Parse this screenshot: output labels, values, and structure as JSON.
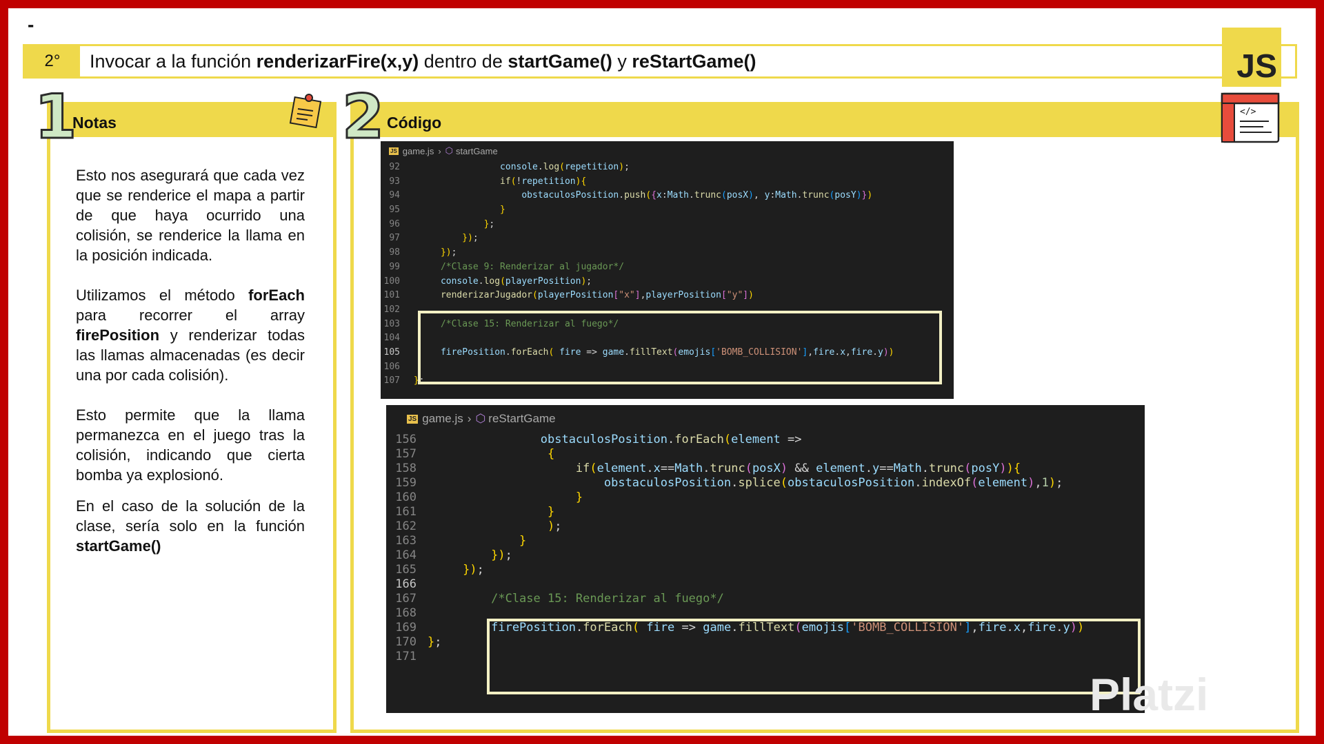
{
  "header": {
    "dash": "-",
    "step": "2°",
    "title_parts": [
      "Invocar a la función ",
      "renderizarFire(x,y)",
      " dentro de ",
      "startGame()",
      " y ",
      "reStartGame()"
    ]
  },
  "badge": "JS",
  "left_panel": {
    "number": "1",
    "label": "Notas",
    "paragraphs": [
      "Esto nos asegurará que cada vez que se renderice el mapa a partir de que haya ocurrido una colisión, se renderice la llama en la posición indicada.",
      [
        "Utilizamos el método ",
        "forEach",
        " para recorrer el array ",
        "firePosition",
        " y renderizar todas las llamas almacenadas (es decir una por cada colisión)."
      ],
      "Esto permite que la llama permanezca en el juego tras la colisión, indicando que cierta bomba ya explosionó.",
      [
        "En el caso de la solución de la clase, sería solo en la función ",
        "startGame()"
      ]
    ]
  },
  "right_panel": {
    "number": "2",
    "label": "Código"
  },
  "code1": {
    "file": "game.js",
    "symbol": "startGame",
    "current_line": "105",
    "lines": [
      {
        "n": "92",
        "t": "console.log(repetition);"
      },
      {
        "n": "93",
        "t": "if(!repetition){"
      },
      {
        "n": "94",
        "t": "obstaculosPosition.push({x:Math.trunc(posX), y:Math.trunc(posY)})"
      },
      {
        "n": "95",
        "t": "}"
      },
      {
        "n": "96",
        "t": "};"
      },
      {
        "n": "97",
        "t": "});"
      },
      {
        "n": "98",
        "t": "});"
      },
      {
        "n": "99",
        "t": "/*Clase 9: Renderizar al jugador*/"
      },
      {
        "n": "100",
        "t": "console.log(playerPosition);"
      },
      {
        "n": "101",
        "t": "renderizarJugador(playerPosition[\"x\"],playerPosition[\"y\"])"
      },
      {
        "n": "102",
        "t": ""
      },
      {
        "n": "103",
        "t": "/*Clase 15: Renderizar al fuego*/"
      },
      {
        "n": "104",
        "t": ""
      },
      {
        "n": "105",
        "t": "firePosition.forEach( fire => game.fillText(emojis['BOMB_COLLISION'],fire.x,fire.y))"
      },
      {
        "n": "106",
        "t": ""
      },
      {
        "n": "107",
        "t": "};"
      }
    ]
  },
  "code2": {
    "file": "game.js",
    "symbol": "reStartGame",
    "current_line": "166",
    "lines": [
      {
        "n": "156",
        "t": "obstaculosPosition.forEach(element =>"
      },
      {
        "n": "157",
        "t": "{"
      },
      {
        "n": "158",
        "t": "if(element.x==Math.trunc(posX) && element.y==Math.trunc(posY)){"
      },
      {
        "n": "159",
        "t": "obstaculosPosition.splice(obstaculosPosition.indexOf(element),1);"
      },
      {
        "n": "160",
        "t": "}"
      },
      {
        "n": "161",
        "t": "}"
      },
      {
        "n": "162",
        "t": ");"
      },
      {
        "n": "163",
        "t": "}"
      },
      {
        "n": "164",
        "t": "});"
      },
      {
        "n": "165",
        "t": "});"
      },
      {
        "n": "166",
        "t": ""
      },
      {
        "n": "167",
        "t": "/*Clase 15: Renderizar al fuego*/"
      },
      {
        "n": "168",
        "t": ""
      },
      {
        "n": "169",
        "t": "firePosition.forEach( fire => game.fillText(emojis['BOMB_COLLISION'],fire.x,fire.y))"
      },
      {
        "n": "170",
        "t": "};"
      },
      {
        "n": "171",
        "t": ""
      }
    ]
  },
  "watermark": "Platzi",
  "colors": {
    "border_red": "#c00000",
    "accent_yellow": "#efd94b",
    "editor_bg": "#1e1e1e",
    "highlight_box": "#f3f0c4"
  },
  "icons": {
    "notes": "sticky-note-icon",
    "code": "code-window-icon",
    "symbol": "method-cube-icon",
    "file": "js-file-icon"
  }
}
